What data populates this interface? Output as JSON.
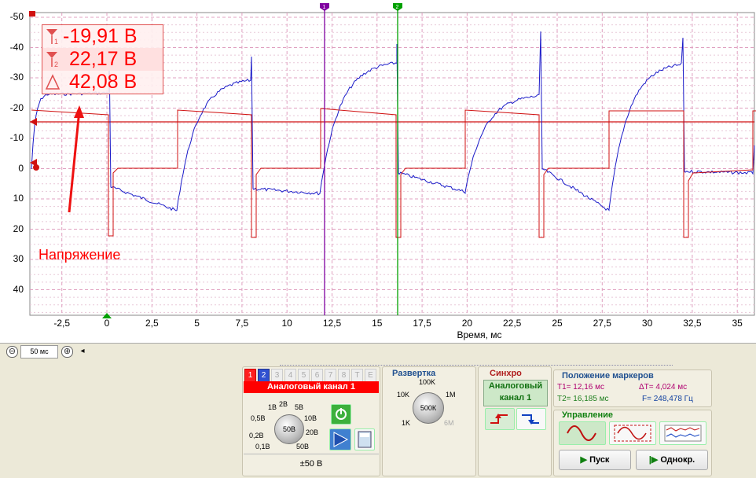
{
  "plot": {
    "y_ticks": [
      "-50",
      "-40",
      "-30",
      "-20",
      "-10",
      "0",
      "10",
      "20",
      "30",
      "40"
    ],
    "x_ticks": [
      "-2,5",
      "0",
      "2,5",
      "5",
      "7,5",
      "10",
      "12,5",
      "15",
      "17,5",
      "20",
      "22,5",
      "25",
      "27,5",
      "30",
      "32,5",
      "35"
    ],
    "x_axis_label": "Время, мс",
    "annotation": "Напряжение",
    "marker_flags": [
      "1",
      "2"
    ],
    "colors": {
      "signal_blue": "#1a1ac8",
      "signal_red": "#d01010",
      "marker1": "#8000a0",
      "marker2": "#00a000",
      "grid": "#e0a0c0"
    }
  },
  "marker_readout": {
    "v1": "-19,91 В",
    "v2": "22,17 В",
    "delta": "42,08 В",
    "v1_sub": "1",
    "v2_sub": "2"
  },
  "timebar": {
    "timebase": "50 мс",
    "zoom_out": "⊖",
    "zoom_in": "⊕",
    "scroll": "◂"
  },
  "channel": {
    "tabs": [
      "1",
      "2",
      "3",
      "4",
      "5",
      "6",
      "7",
      "8",
      "T",
      "E"
    ],
    "banner": "Аналоговый канал 1",
    "knob_value": "50В",
    "knob_labels": [
      "1В",
      "2В",
      "5В",
      "0,5В",
      "10В",
      "0,2В",
      "20В",
      "0,1В",
      "50В"
    ],
    "range_value": "±50 В"
  },
  "sweep": {
    "title": "Развертка",
    "knob_value": "500К",
    "labels": [
      "100K",
      "10K",
      "1M",
      "1K",
      "6M"
    ]
  },
  "sync": {
    "title": "Синхро",
    "source_line1": "Аналоговый",
    "source_line2": "канал 1"
  },
  "markers": {
    "title": "Положение маркеров",
    "t1": "T1= 12,16 мс",
    "t2": "T2= 16,185 мс",
    "dt": "ΔT= 4,024 мс",
    "f": "F= 248,478 Гц"
  },
  "control": {
    "title": "Управление",
    "start": "Пуск",
    "single": "Однокр."
  }
}
